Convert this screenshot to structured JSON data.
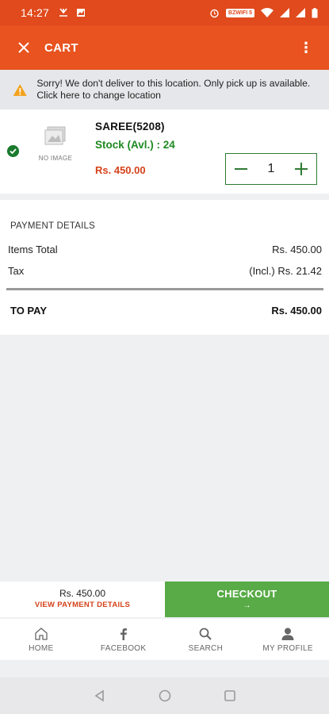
{
  "status_bar": {
    "time": "14:27",
    "wifi_badge": "BZWIFI 5"
  },
  "app_bar": {
    "title": "CART"
  },
  "warning": {
    "text": "Sorry! We don't deliver to this location. Only pick up is available. Click here to change location"
  },
  "cart_item": {
    "image_placeholder": "NO IMAGE",
    "name": "SAREE(5208)",
    "stock": "Stock (Avl.) : 24",
    "price": "Rs. 450.00",
    "quantity": "1"
  },
  "payment_details": {
    "title": "PAYMENT DETAILS",
    "rows": [
      {
        "label": "Items Total",
        "value": "Rs. 450.00"
      },
      {
        "label": "Tax",
        "value": "(Incl.) Rs. 21.42"
      }
    ],
    "total_label": "TO PAY",
    "total_value": "Rs. 450.00"
  },
  "footer": {
    "amount": "Rs. 450.00",
    "details_link": "VIEW PAYMENT DETAILS",
    "checkout_label": "CHECKOUT",
    "checkout_arrow": "→"
  },
  "bottom_nav": [
    {
      "label": "HOME",
      "icon": "home-icon"
    },
    {
      "label": "FACEBOOK",
      "icon": "facebook-icon"
    },
    {
      "label": "SEARCH",
      "icon": "search-icon"
    },
    {
      "label": "MY PROFILE",
      "icon": "profile-icon"
    }
  ],
  "colors": {
    "brand": "#e8531f",
    "success": "#1e8a22",
    "price": "#d4421a",
    "checkout": "#58ab46"
  }
}
